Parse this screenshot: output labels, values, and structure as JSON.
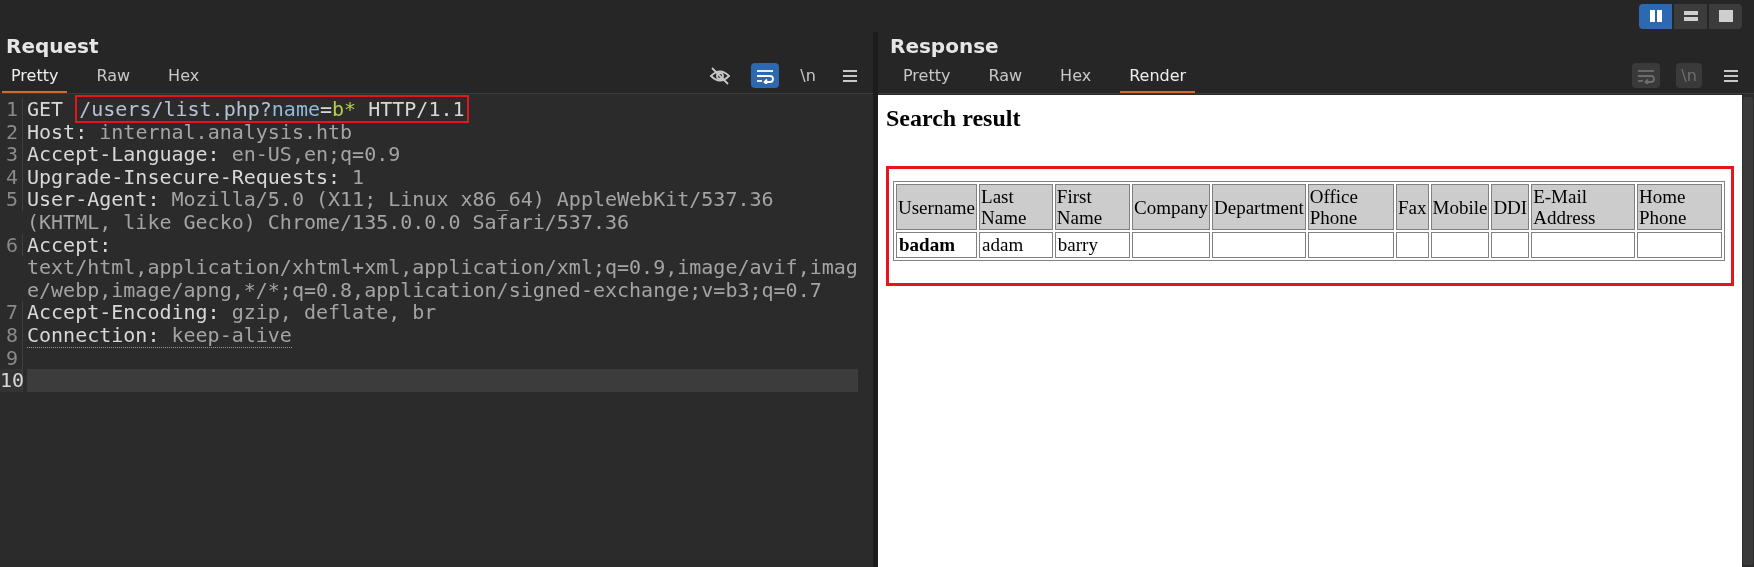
{
  "layout_buttons": [
    {
      "kind": "columns",
      "selected": true
    },
    {
      "kind": "rows",
      "selected": false
    },
    {
      "kind": "single",
      "selected": false
    }
  ],
  "request": {
    "title": "Request",
    "tabs": [
      {
        "label": "Pretty",
        "selected": true
      },
      {
        "label": "Raw",
        "selected": false
      },
      {
        "label": "Hex",
        "selected": false
      }
    ],
    "toolbar": [
      {
        "kind": "hide",
        "selected": false,
        "disabled": false
      },
      {
        "kind": "wrap",
        "selected": true,
        "disabled": false
      },
      {
        "kind": "newline",
        "label": "\\n",
        "selected": false,
        "disabled": false
      },
      {
        "kind": "menu"
      }
    ],
    "lines": [
      {
        "number": "1",
        "current": false,
        "underlined": false,
        "segments": [
          {
            "text": "GET ",
            "kind": "method"
          }
        ],
        "highlighted": [
          {
            "text": "/users/list.php?",
            "kind": "path"
          },
          {
            "text": "name",
            "kind": "param"
          },
          {
            "text": "=",
            "kind": "plain"
          },
          {
            "text": "b*",
            "kind": "value"
          },
          {
            "text": " HTTP/1.1",
            "kind": "plain"
          }
        ]
      },
      {
        "number": "2",
        "current": false,
        "underlined": false,
        "segments": [
          {
            "text": "Host:",
            "kind": "header-name"
          },
          {
            "text": " internal.analysis.htb",
            "kind": "header-value"
          }
        ]
      },
      {
        "number": "3",
        "current": false,
        "underlined": false,
        "segments": [
          {
            "text": "Accept-Language:",
            "kind": "header-name"
          },
          {
            "text": " en-US,en;q=0.9",
            "kind": "header-value"
          }
        ]
      },
      {
        "number": "4",
        "current": false,
        "underlined": false,
        "segments": [
          {
            "text": "Upgrade-Insecure-Requests:",
            "kind": "header-name"
          },
          {
            "text": " 1",
            "kind": "header-value"
          }
        ]
      },
      {
        "number": "5",
        "current": false,
        "underlined": false,
        "segments": [
          {
            "text": "User-Agent:",
            "kind": "header-name"
          },
          {
            "text": " Mozilla/5.0 (X11; Linux x86_64) AppleWebKit/537.36 (KHTML, like Gecko) Chrome/135.0.0.0 Safari/537.36",
            "kind": "header-value"
          }
        ]
      },
      {
        "number": "6",
        "current": false,
        "underlined": false,
        "segments": [
          {
            "text": "Accept:",
            "kind": "header-name"
          },
          {
            "text": " text/html,application/xhtml+xml,application/xml;q=0.9,image/avif,image/webp,image/apng,*/*;q=0.8,application/signed-exchange;v=b3;q=0.7",
            "kind": "header-value"
          }
        ]
      },
      {
        "number": "7",
        "current": false,
        "underlined": false,
        "segments": [
          {
            "text": "Accept-Encoding:",
            "kind": "header-name"
          },
          {
            "text": " gzip, deflate, br",
            "kind": "header-value"
          }
        ]
      },
      {
        "number": "8",
        "current": false,
        "underlined": true,
        "segments": [
          {
            "text": "Connection:",
            "kind": "header-name"
          },
          {
            "text": " keep-alive",
            "kind": "header-value"
          }
        ]
      },
      {
        "number": "9",
        "current": false,
        "underlined": false
      },
      {
        "number": "10",
        "current": true,
        "underlined": false
      }
    ]
  },
  "response": {
    "title": "Response",
    "tabs": [
      {
        "label": "Pretty",
        "selected": false
      },
      {
        "label": "Raw",
        "selected": false
      },
      {
        "label": "Hex",
        "selected": false
      },
      {
        "label": "Render",
        "selected": true
      }
    ],
    "toolbar": [
      {
        "kind": "wrap",
        "selected": false,
        "disabled": true
      },
      {
        "kind": "newline",
        "label": "\\n",
        "selected": false,
        "disabled": true
      },
      {
        "kind": "menu"
      }
    ],
    "render": {
      "heading": "Search result",
      "highlighted": true,
      "columns": [
        "Username",
        "Last Name",
        "First Name",
        "Company",
        "Department",
        "Office Phone",
        "Fax",
        "Mobile",
        "DDI",
        "E-Mail Address",
        "Home Phone"
      ],
      "rows": [
        {
          "cells": [
            {
              "text": "badam",
              "bold": true
            },
            {
              "text": "adam",
              "bold": false
            },
            {
              "text": "barry",
              "bold": false
            }
          ]
        }
      ]
    }
  }
}
